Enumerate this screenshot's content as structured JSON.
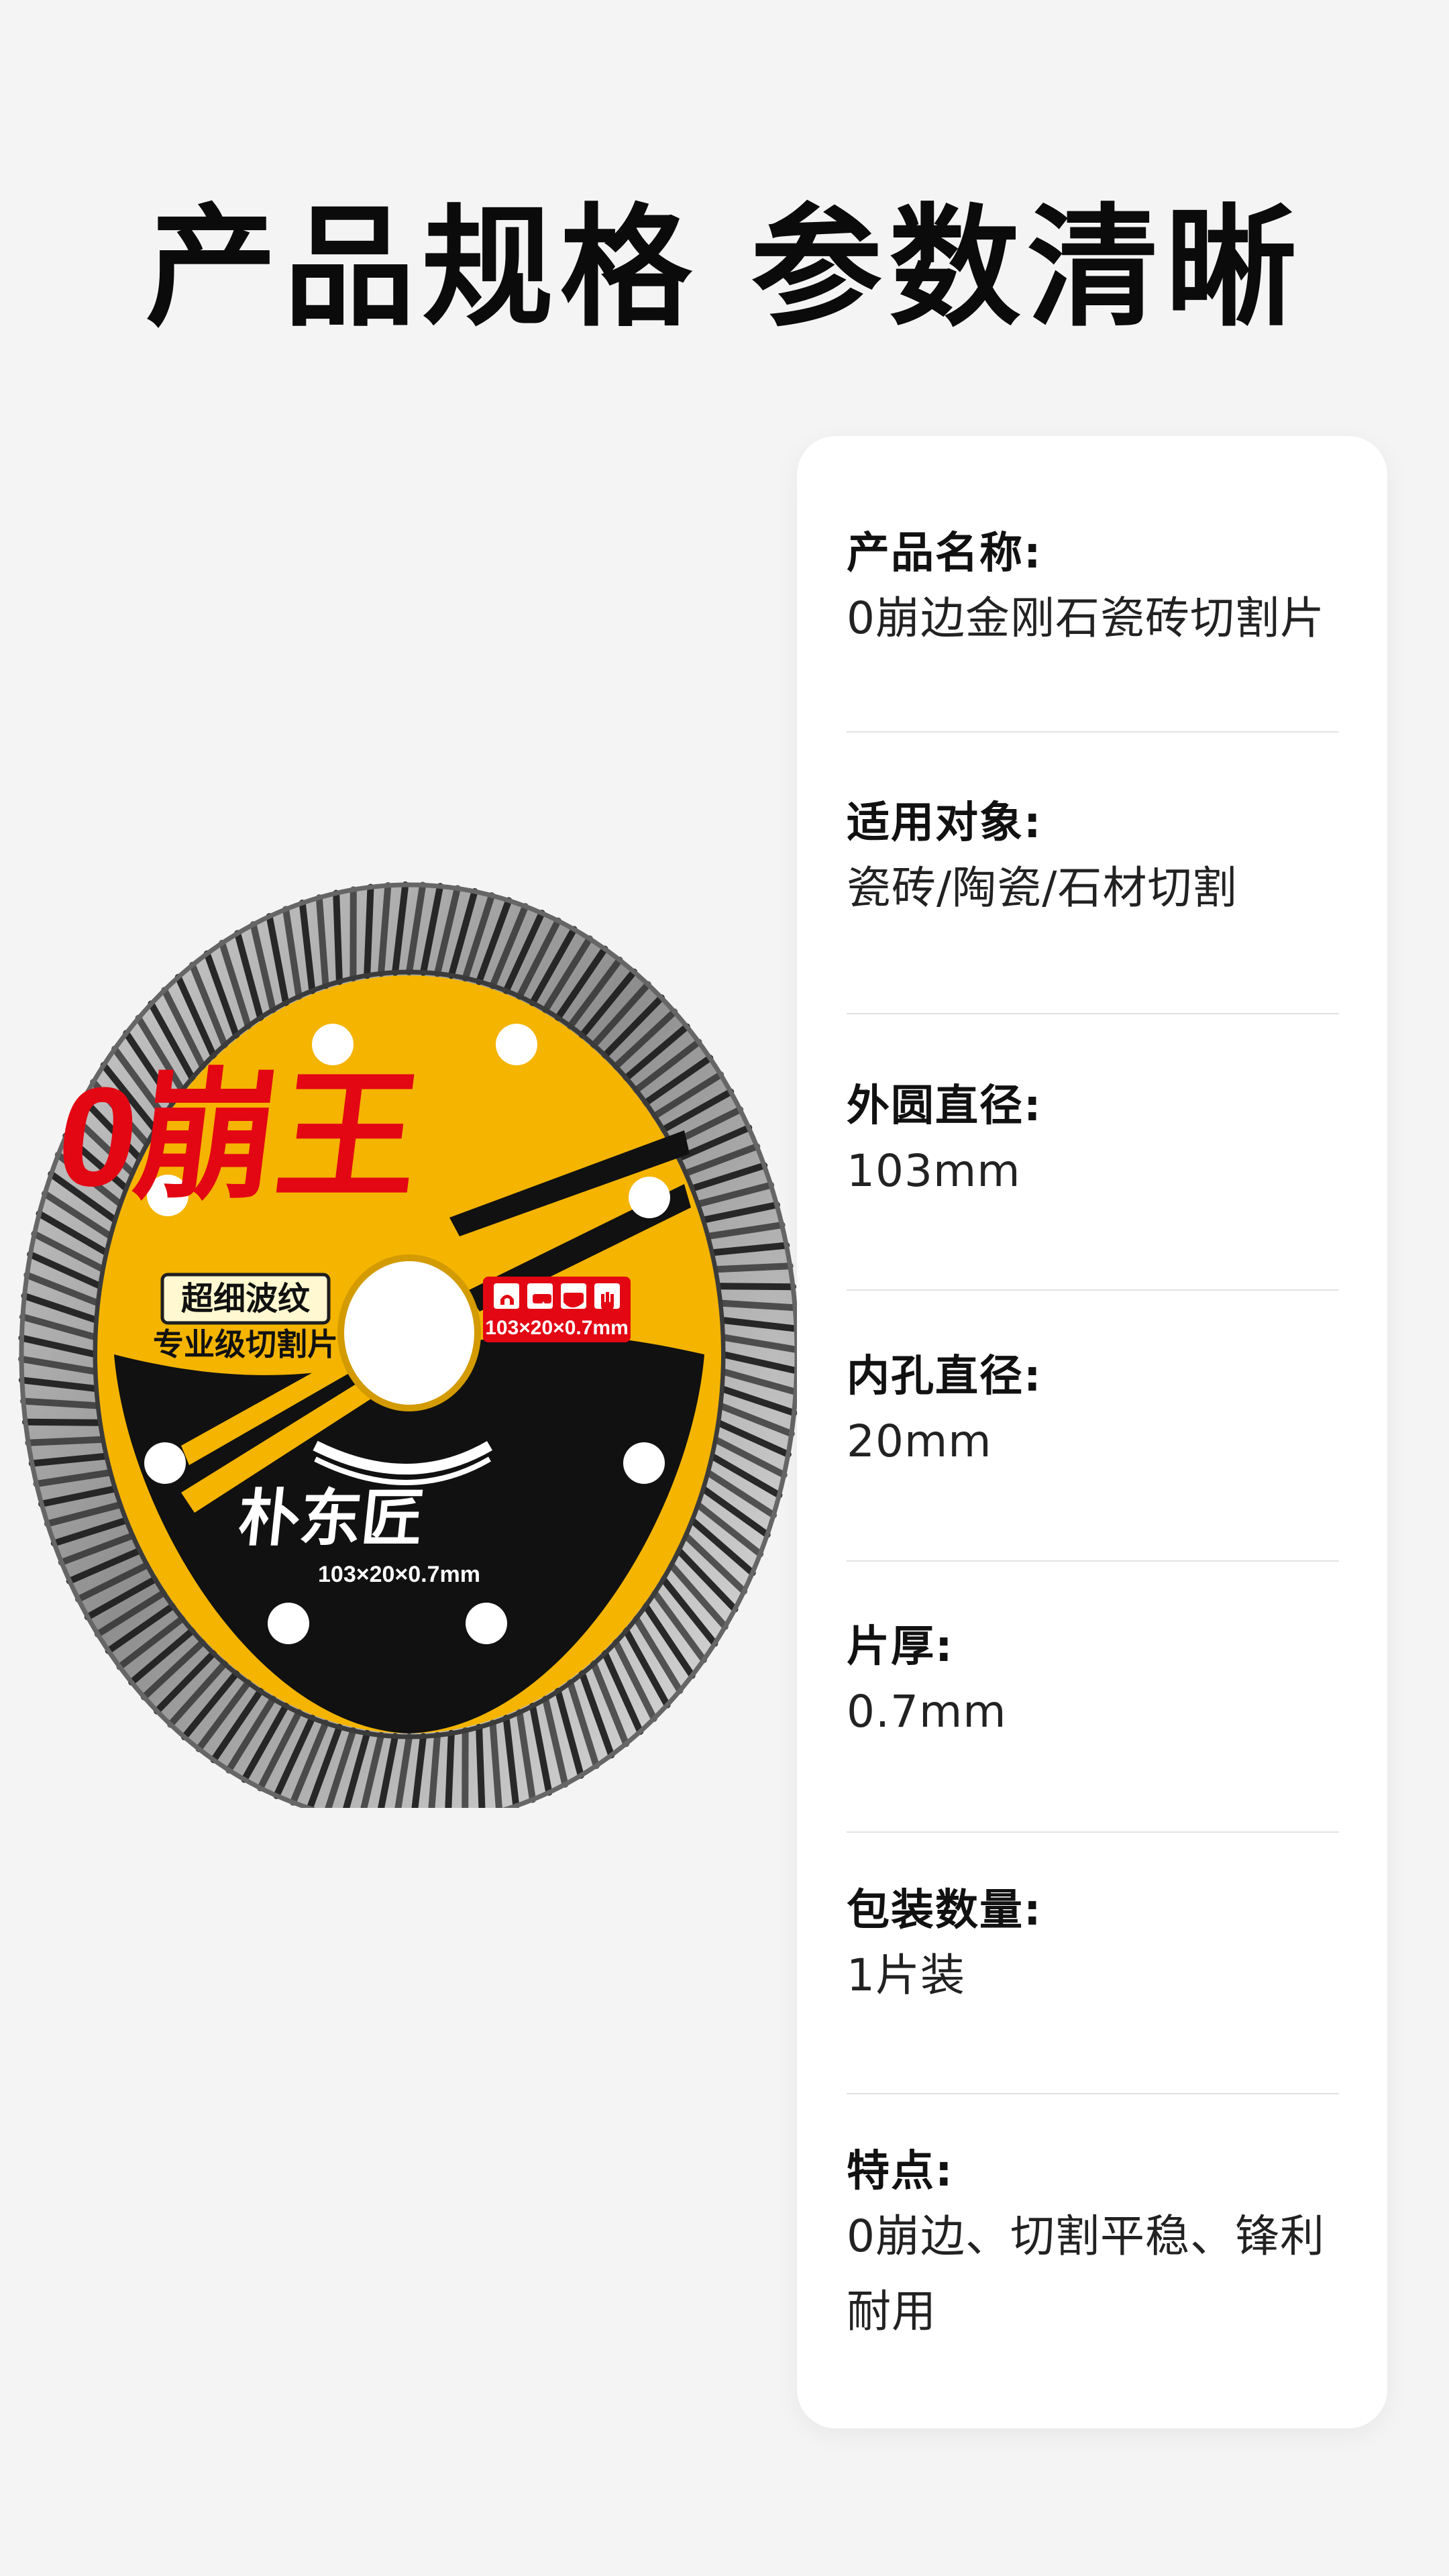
{
  "headline": "产品规格 参数清晰",
  "disc": {
    "brand_text": "0崩王",
    "pattern_label": "超细波纹",
    "grade_label": "专业级切割片",
    "size_badge": "103×20×0.7mm",
    "maker_label": "朴东匠",
    "bottom_size_label": "103×20×0.7mm",
    "colors": {
      "yellow": "#f4b400",
      "black": "#111111",
      "red": "#e30613",
      "ring_silver": "#bdbdbd",
      "ring_dark": "#2a2a2a"
    },
    "safety_icons": [
      "ear-protection-icon",
      "goggles-icon",
      "mask-icon",
      "gloves-icon"
    ]
  },
  "specs": [
    {
      "label": "产品名称:",
      "value": "0崩边金刚石瓷砖切割片"
    },
    {
      "label": "适用对象:",
      "value": "瓷砖/陶瓷/石材切割"
    },
    {
      "label": "外圆直径:",
      "value": "103mm"
    },
    {
      "label": "内孔直径:",
      "value": "20mm"
    },
    {
      "label": "片厚:",
      "value": "0.7mm"
    },
    {
      "label": "包装数量:",
      "value": "1片装"
    },
    {
      "label": "特点:",
      "value": "0崩边、切割平稳、锋利耐用"
    }
  ]
}
